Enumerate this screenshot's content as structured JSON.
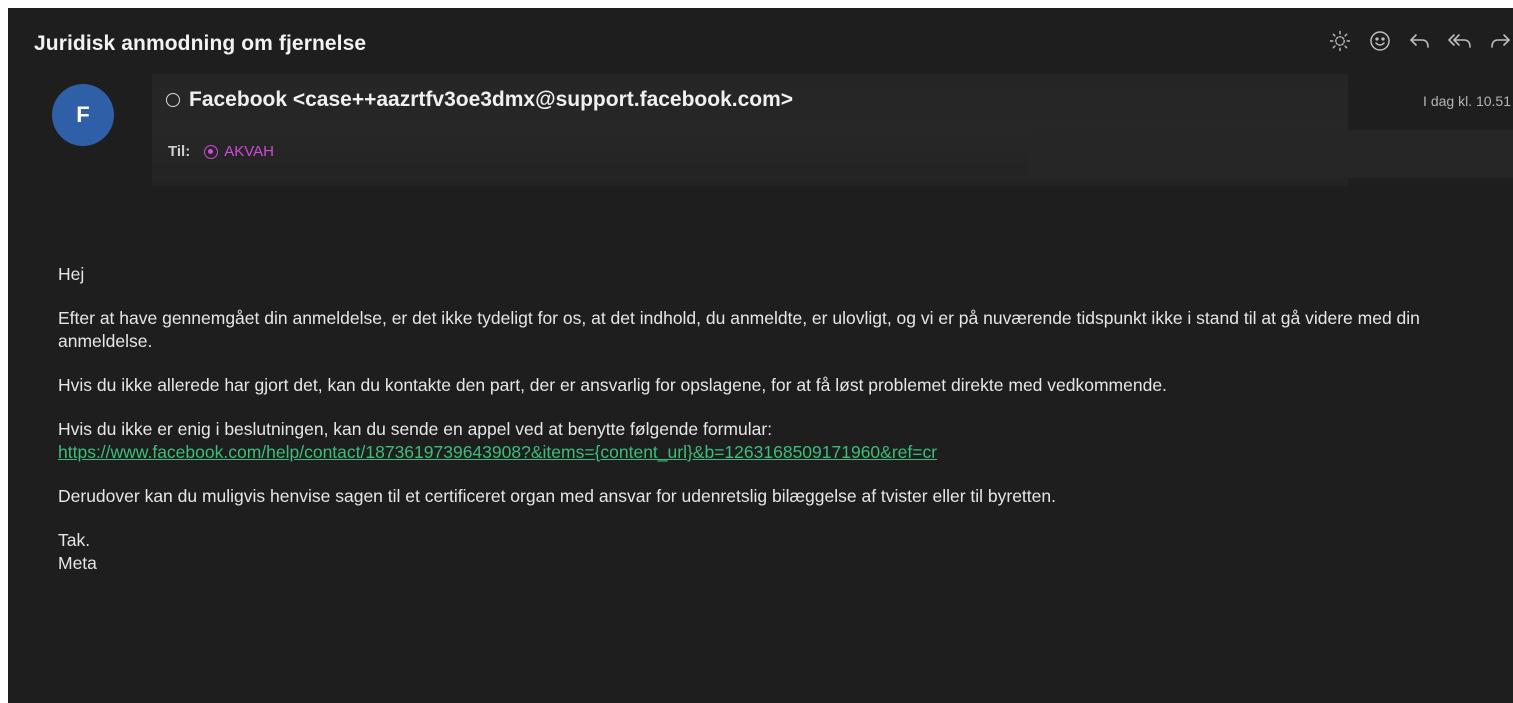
{
  "email": {
    "subject": "Juridisk anmodning om fjernelse",
    "toolbar": {
      "icons": [
        "sun-icon",
        "smiley-icon",
        "reply-icon",
        "reply-all-icon",
        "forward-icon"
      ]
    },
    "sender": {
      "avatar_letter": "F",
      "display": "Facebook <case++aazrtfv3oe3dmx@support.facebook.com>",
      "avatar_color": "#2f5fa7"
    },
    "date": "I dag kl. 10.51",
    "to": {
      "label": "Til:",
      "name": "AKVAH",
      "color": "#d04bd8"
    },
    "body": {
      "greeting": "Hej",
      "para1": "Efter at have gennemgået din anmeldelse, er det ikke tydeligt for os, at det indhold, du anmeldte, er ulovligt, og vi er på nuværende tidspunkt ikke i stand til at gå videre med din anmeldelse.",
      "para2": "Hvis du ikke allerede har gjort det, kan du kontakte den part, der er ansvarlig for opslagene, for at få løst problemet direkte med vedkommende.",
      "para3": "Hvis du ikke er enig i beslutningen, kan du sende en appel ved at benytte følgende formular:",
      "link": "https://www.facebook.com/help/contact/1873619739643908?&items={content_url}&b=1263168509171960&ref=cr",
      "para4": "Derudover kan du muligvis henvise sagen til et certificeret organ med ansvar for udenretslig bilæggelse af tvister eller til byretten.",
      "closing": "Tak.",
      "signature": "Meta"
    },
    "link_color": "#3dbd7c"
  }
}
